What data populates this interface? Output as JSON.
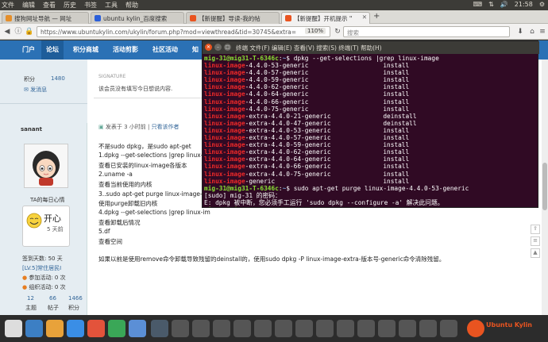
{
  "topbar": {
    "menus": [
      "文件",
      "编辑",
      "查看",
      "历史",
      "书签",
      "工具",
      "帮助"
    ],
    "clock": "21:58"
  },
  "tabs": [
    {
      "label": "搜狗网址导航 — 网址",
      "color": "#e58f2b"
    },
    {
      "label": "ubuntu kylin_百度搜索",
      "color": "#2b5fd9"
    },
    {
      "label": "【新提醒】导读-我的帖",
      "color": "#e95420"
    },
    {
      "label": "【新提醒】开机提示 \"",
      "color": "#e95420"
    }
  ],
  "navbar": {
    "url": "https://www.ubuntukylin.com/ukylin/forum.php?mod=viewthread&tid=30745&extra=",
    "zoom": "110%",
    "search_placeholder": "搜索"
  },
  "forum_nav": [
    "门户",
    "论坛",
    "积分商城",
    "活动剪影",
    "社区活动",
    "知"
  ],
  "sidebar": {
    "points_label": "积分",
    "points_value": "1480",
    "send_message": "发消息",
    "username": "sanant",
    "mood_title": "TA的每日心情",
    "mood": "开心",
    "mood_days": "5 天前",
    "signin": "签到天数: 50 天",
    "level": "[LV.5]常住居民I",
    "participate": "参加活动: 0 次",
    "organize": "组织活动: 0 次",
    "stats": [
      {
        "value": "12",
        "label": "主题"
      },
      {
        "value": "66",
        "label": "帖子"
      },
      {
        "value": "1466",
        "label": "积分"
      }
    ]
  },
  "post": {
    "signature_label": "SIGNATURE",
    "signature_text": "该会员没有填写今日想说内容.",
    "posted": "发表于 3 小时前",
    "only_author": "只看该作者",
    "lines": [
      "不是sudo dpkg，是sudo apt-get",
      "1.dpkg --get-selections |grep linux-im",
      "查看已安装的linux-image各版本",
      "2.uname -a",
      "查看当前使用的内核",
      "3..sudo apt-get purge linux-image-版",
      "使用purge卸载旧内核",
      "4.dpkg --get-selections |grep linux-im",
      "查看卸载后情况",
      "5.df",
      "查看空间"
    ],
    "footer": "如果以前是使用remove命令卸载导致残留的deinstall的，使用sudo dpkg -P linux-image-extra-版本号-generic命令清除残留。"
  },
  "terminal": {
    "title": "mig-31@mig31-T-6346c: ~",
    "menu": "终端    文件(F)   编辑(E)   查看(V)   搜索(S)   终端(T)   帮助(H)",
    "prompt": "mig-31@mig31-T-6346c",
    "cmd1": "dpkg --get-selections |grep linux-image",
    "packages": [
      {
        "name": "-4.4.0-53-generic",
        "state": "install"
      },
      {
        "name": "-4.4.0-57-generic",
        "state": "install"
      },
      {
        "name": "-4.4.0-59-generic",
        "state": "install"
      },
      {
        "name": "-4.4.0-62-generic",
        "state": "install"
      },
      {
        "name": "-4.4.0-64-generic",
        "state": "install"
      },
      {
        "name": "-4.4.0-66-generic",
        "state": "install"
      },
      {
        "name": "-4.4.0-75-generic",
        "state": "install"
      },
      {
        "name": "-extra-4.4.0-21-generic",
        "state": "deinstall"
      },
      {
        "name": "-extra-4.4.0-47-generic",
        "state": "deinstall"
      },
      {
        "name": "-extra-4.4.0-53-generic",
        "state": "install"
      },
      {
        "name": "-extra-4.4.0-57-generic",
        "state": "install"
      },
      {
        "name": "-extra-4.4.0-59-generic",
        "state": "install"
      },
      {
        "name": "-extra-4.4.0-62-generic",
        "state": "install"
      },
      {
        "name": "-extra-4.4.0-64-generic",
        "state": "install"
      },
      {
        "name": "-extra-4.4.0-66-generic",
        "state": "install"
      },
      {
        "name": "-extra-4.4.0-75-generic",
        "state": "install"
      },
      {
        "name": "-generic",
        "state": "install"
      }
    ],
    "pkg_prefix": "linux-image",
    "cmd2": "sudo apt-get purge linux-image-4.4.0-53-generic",
    "sudo_prompt": "[sudo] mig-31 的密码：",
    "error": "E: dpkg 被中断，您必须手工运行 'sudo dpkg --configure -a' 解决此问题。"
  },
  "brand": "Ubuntu Kylin"
}
